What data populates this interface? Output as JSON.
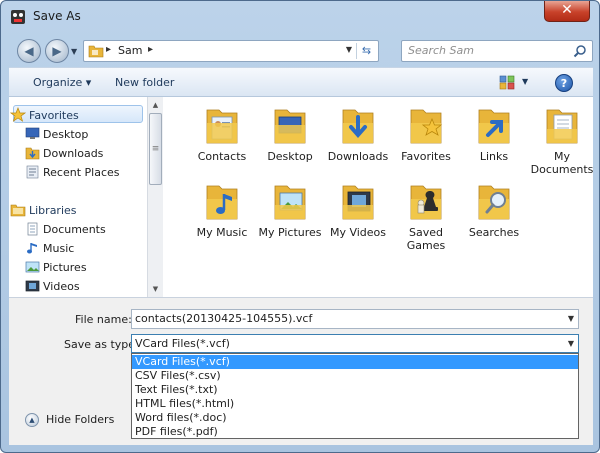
{
  "window": {
    "title": "Save As"
  },
  "navbar": {
    "breadcrumb": "Sam",
    "search_placeholder": "Search Sam"
  },
  "toolbar": {
    "organize": "Organize ▾",
    "new_folder": "New folder"
  },
  "sidebar": {
    "favorites": "Favorites",
    "favorites_items": [
      "Desktop",
      "Downloads",
      "Recent Places"
    ],
    "libraries": "Libraries",
    "libraries_items": [
      "Documents",
      "Music",
      "Pictures",
      "Videos"
    ]
  },
  "files": [
    {
      "label": "Contacts"
    },
    {
      "label": "Desktop"
    },
    {
      "label": "Downloads"
    },
    {
      "label": "Favorites"
    },
    {
      "label": "Links"
    },
    {
      "label": "My Documents"
    },
    {
      "label": "My Music"
    },
    {
      "label": "My Pictures"
    },
    {
      "label": "My Videos"
    },
    {
      "label": "Saved Games"
    },
    {
      "label": "Searches"
    }
  ],
  "save_form": {
    "file_name_label": "File name:",
    "file_name_value": "contacts(20130425-104555).vcf",
    "save_type_label": "Save as type:",
    "save_type_value": "VCard Files(*.vcf)",
    "type_options": [
      "VCard Files(*.vcf)",
      "CSV Files(*.csv)",
      "Text Files(*.txt)",
      "HTML files(*.html)",
      "Word files(*.doc)",
      "PDF files(*.pdf)"
    ],
    "selected_option_index": 0
  },
  "hide_folders": "Hide Folders",
  "colors": {
    "selection": "#3399ff",
    "folder": "#f2c94c",
    "close": "#c8422a"
  }
}
